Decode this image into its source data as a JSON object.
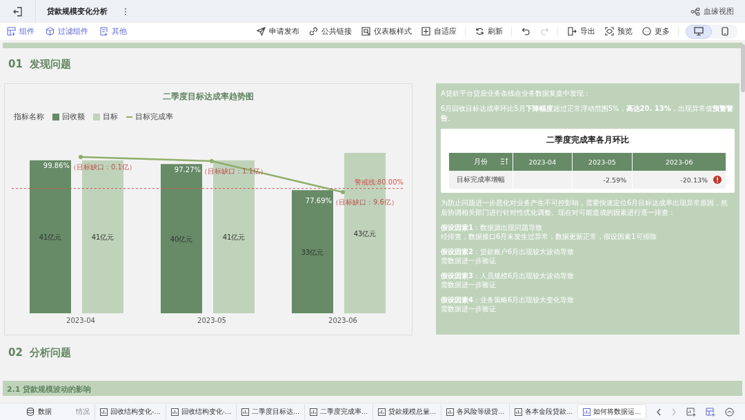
{
  "header": {
    "title": "贷款规模变化分析",
    "lineage": "血缘视图"
  },
  "toolbar_left": [
    {
      "kind": "component",
      "label": "组件"
    },
    {
      "kind": "filter",
      "label": "过滤组件"
    },
    {
      "kind": "other",
      "label": "其他"
    }
  ],
  "toolbar_right": [
    {
      "kind": "send",
      "label": "申请发布"
    },
    {
      "kind": "link",
      "label": "公共链接"
    },
    {
      "kind": "style",
      "label": "仪表板样式"
    },
    {
      "kind": "fit",
      "label": "自适应"
    },
    {
      "kind": "refresh",
      "label": "刷新"
    },
    {
      "kind": "undo",
      "disabled": false
    },
    {
      "kind": "redo",
      "disabled": true
    },
    {
      "kind": "export",
      "label": "导出"
    },
    {
      "kind": "preview",
      "label": "预览"
    },
    {
      "kind": "more",
      "label": "更多"
    }
  ],
  "devices": [
    {
      "kind": "desktop",
      "selected": true
    },
    {
      "kind": "mobile",
      "selected": false
    }
  ],
  "section_1": {
    "number": "01",
    "title": "发现问题"
  },
  "chart": {
    "title": "二季度目标达成率趋势图",
    "legend_title": "指标名称",
    "gap_labels": [
      "（目标缺口：0.1亿）",
      "（目标缺口：1.1亿）",
      "（目标缺口：9.6亿）"
    ],
    "rate_series": {
      "name": "目标完成率",
      "color": "#8fae6a",
      "labels": [
        "99.86%",
        "97.27%",
        "77.69%"
      ]
    },
    "threshold": {
      "label": "警戒线:80.00%",
      "color": "#d9534f"
    },
    "chart_data": {
      "type": "bar",
      "categories": [
        "2023-04",
        "2023-05",
        "2023-06"
      ],
      "series": [
        {
          "name": "回收额",
          "color": "#668b66",
          "values": [
            41,
            40,
            33
          ],
          "value_labels": [
            "41亿元",
            "40亿元",
            "33亿元"
          ]
        },
        {
          "name": "目标",
          "color": "#bfd3bb",
          "values": [
            41,
            41,
            43
          ],
          "value_labels": [
            "41亿元",
            "41亿元",
            "43亿元"
          ]
        }
      ]
    }
  },
  "findings": {
    "intro": "A贷款平台贷后业务条线在业务数据复盘中发现：",
    "alert": "6月回收目标达成率环比5月**下降幅度**超过正常浮动范围5%，**高达20. 13%**，出现异常值**预警警告**。",
    "table": {
      "title": "二季度完成率各月环比",
      "columns": [
        "月份",
        "2023-04",
        "2023-05",
        "2023-06"
      ],
      "rows": [
        {
          "cells": [
            {
              "value": "目标完成率增幅",
              "alert": false
            },
            {
              "alert": false
            },
            {
              "value": "-2.59%",
              "alert": false
            },
            {
              "value": "-20.13%",
              "alert": true
            }
          ]
        }
      ]
    },
    "summary": "为防止问题进一步恶化对业务产生不可控影响，需要快速定位6月目标达成率出现异常原因，然后协调相关部门进行针对性优化调整。现在对可能造成的因素进行逐一排查：",
    "hypotheses": [
      {
        "title": "**假设因素1**：数据源出现问题导致",
        "note": "经排查，数据接口6月未发生过异常，数据更新正常，假设因素1可排除"
      },
      {
        "title": "**假设因素2**：贷款账户6月出现较大波动导致",
        "note": "需数据进一步验证"
      },
      {
        "title": "**假设因素3**：人员规模6月出现较大波动导致",
        "note": "需数据进一步验证"
      },
      {
        "title": "**假设因素4**：业务策略6月出现较大变化导致",
        "note": "需数据进一步验证"
      }
    ]
  },
  "section_2": {
    "number": "02",
    "title": "分析问题"
  },
  "subsection": {
    "title": "2.1 贷款规模波动的影响"
  },
  "bottom_bar": {
    "data_label": "数据",
    "tabs": [
      {
        "label": "情况",
        "selected": false
      },
      {
        "label": "回收结构变化-...",
        "selected": false
      },
      {
        "label": "回收结构变化-...",
        "selected": false
      },
      {
        "label": "二季度目标达...",
        "selected": false
      },
      {
        "label": "二季度完成率...",
        "selected": false
      },
      {
        "label": "贷款规模总量...",
        "selected": false
      },
      {
        "label": "各风险等级贷...",
        "selected": false
      },
      {
        "label": "各本金段贷款...",
        "selected": false
      },
      {
        "label": "如何将数据运...",
        "selected": true
      }
    ]
  }
}
